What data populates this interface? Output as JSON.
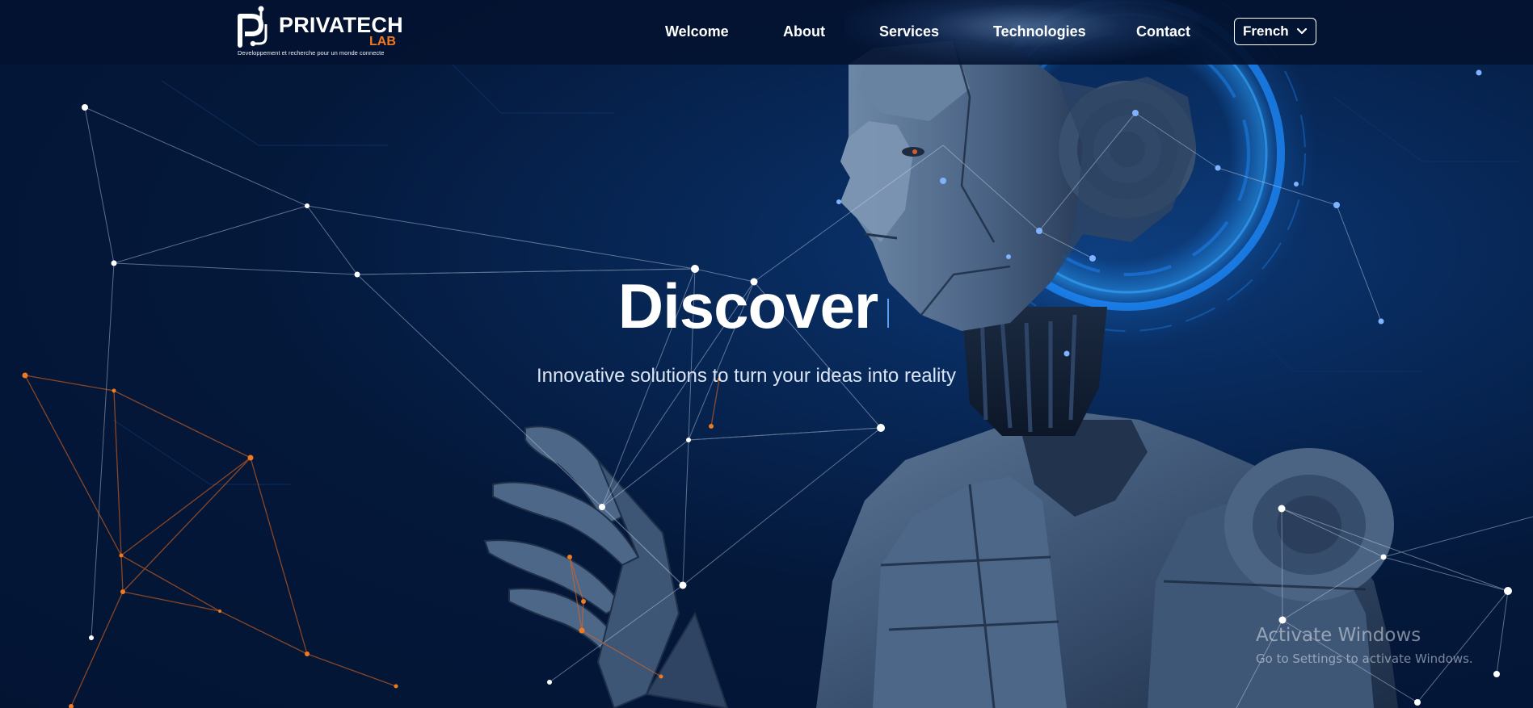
{
  "brand": {
    "name": "PRIVATECH",
    "suffix": "LAB",
    "tagline": "Developpement et recherche pour un monde connecte"
  },
  "nav": {
    "items": [
      {
        "label": "Welcome"
      },
      {
        "label": "About"
      },
      {
        "label": "Services"
      },
      {
        "label": "Technologies"
      },
      {
        "label": "Contact"
      }
    ],
    "language": {
      "selected": "French",
      "icon": "chevron-down-icon"
    }
  },
  "hero": {
    "title": "Discover",
    "subtitle": "Innovative solutions to turn your ideas into reality",
    "background": "robot-illustration with network nodes"
  },
  "os_watermark": {
    "title": "Activate Windows",
    "subtitle": "Go to Settings to activate Windows."
  },
  "colors": {
    "background": "#04183a",
    "accent_orange": "#f07a1f",
    "glow_blue": "#1e8cff",
    "text": "#ffffff"
  }
}
